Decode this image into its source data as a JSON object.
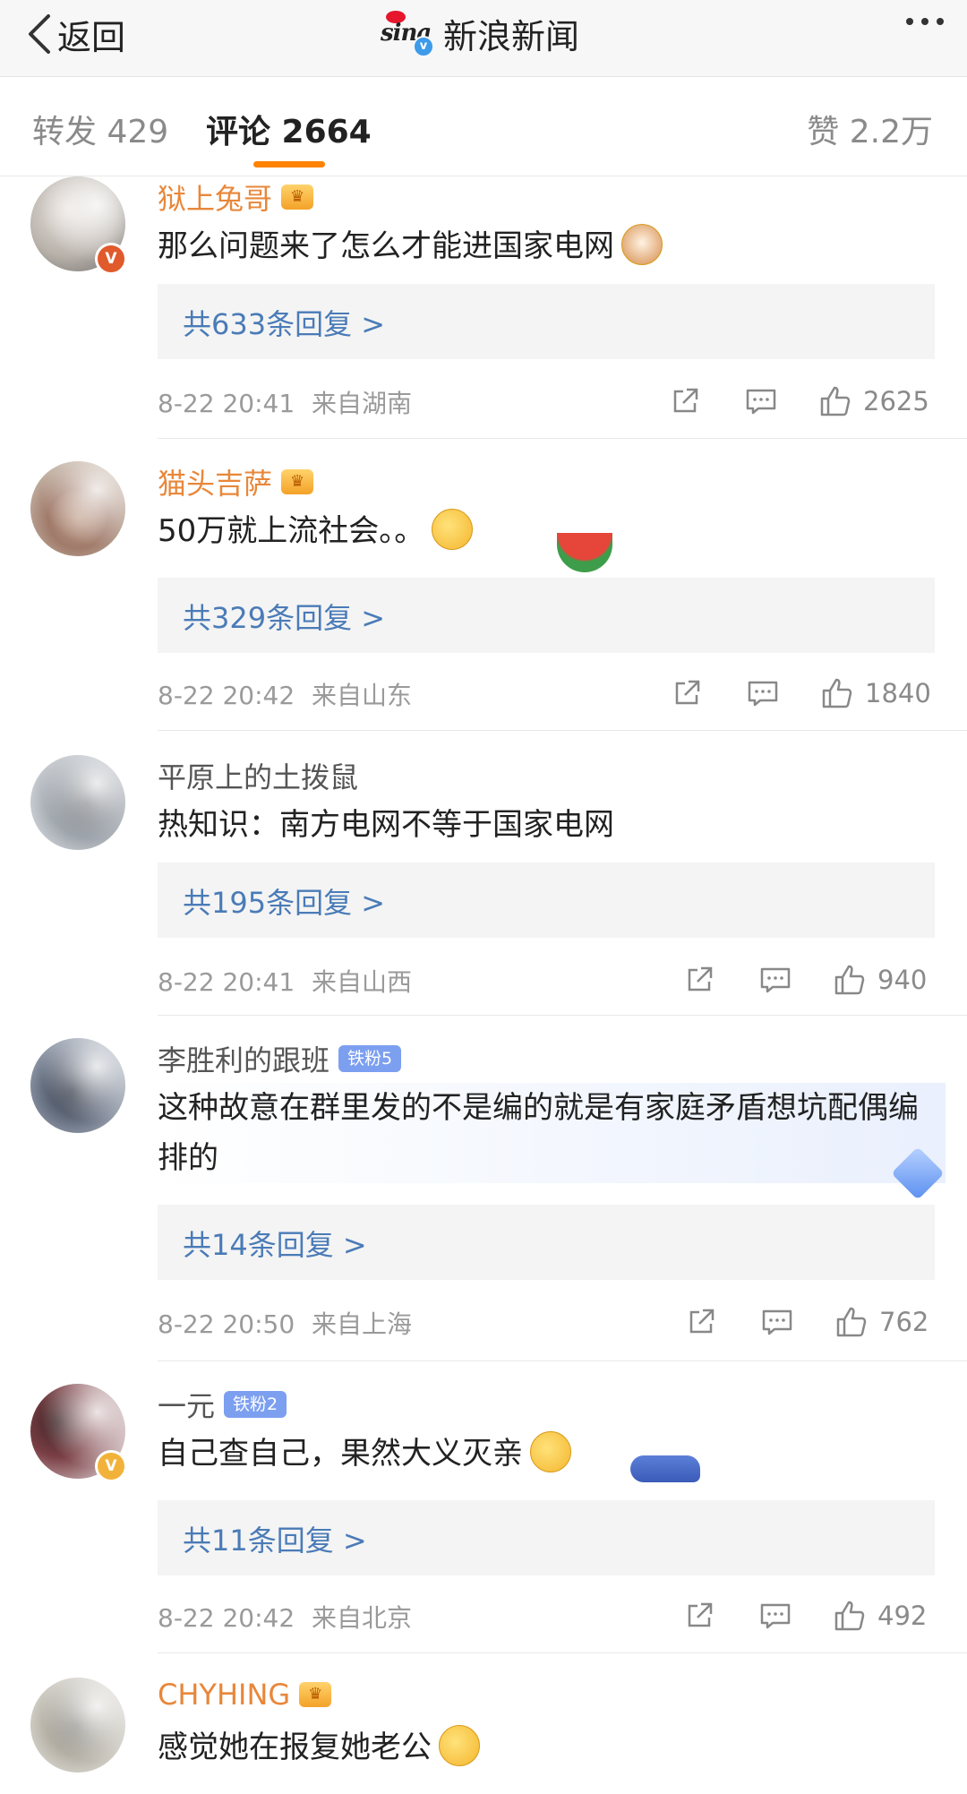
{
  "topbar": {
    "back_label": "返回",
    "brand_name": "新浪新闻",
    "logo_text": "sina"
  },
  "tabs": {
    "repost": "转发 429",
    "comments": "评论 2664",
    "likes": "赞 2.2万"
  },
  "comments": [
    {
      "username": "狱上兔哥",
      "user_badge": "crown",
      "verified": "red",
      "text": "那么问题来了怎么才能进国家电网",
      "emoji": "cat-face-emoji",
      "replies": "共633条回复 >",
      "time": "8-22 20:41",
      "location": "来自湖南",
      "likes": "2625"
    },
    {
      "username": "猫头吉萨",
      "user_badge": "crown",
      "verified": "",
      "text": "50万就上流社会。。",
      "emoji": "laughing-tears-emoji",
      "replies": "共329条回复 >",
      "time": "8-22 20:42",
      "location": "来自山东",
      "likes": "1840"
    },
    {
      "username": "平原上的土拨鼠",
      "user_badge": "",
      "verified": "",
      "text": "热知识：南方电网不等于国家电网",
      "emoji": "",
      "replies": "共195条回复 >",
      "time": "8-22 20:41",
      "location": "来自山西",
      "likes": "940"
    },
    {
      "username": "李胜利的跟班",
      "user_badge": "铁粉5",
      "verified": "",
      "text": "这种故意在群里发的不是编的就是有家庭矛盾想坑配偶编排的",
      "emoji": "",
      "replies": "共14条回复 >",
      "time": "8-22 20:50",
      "location": "来自上海",
      "likes": "762"
    },
    {
      "username": "一元",
      "user_badge": "铁粉2",
      "verified": "gold",
      "text": "自己查自己，果然大义灭亲",
      "emoji": "laughing-tears-emoji",
      "replies": "共11条回复 >",
      "time": "8-22 20:42",
      "location": "来自北京",
      "likes": "492"
    },
    {
      "username": "CHYHING",
      "user_badge": "crown",
      "verified": "",
      "text": "感觉她在报复她老公",
      "emoji": "sad-face-emoji"
    }
  ],
  "colors": {
    "accent": "#ff8200",
    "link": "#4a7bb7",
    "meta": "#9a9a9a"
  }
}
